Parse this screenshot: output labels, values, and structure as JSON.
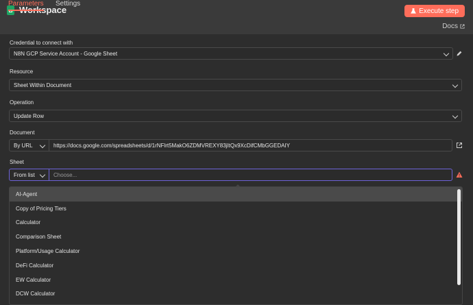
{
  "header": {
    "title": "Workspace",
    "execute_label": "Execute step",
    "tabs": [
      {
        "label": "Parameters"
      },
      {
        "label": "Settings"
      }
    ],
    "docs_label": "Docs"
  },
  "colors": {
    "accent": "#ff6d5a",
    "sheet_green": "#1fa463",
    "focus": "#6e63d9",
    "warning": "#ff6d5a"
  },
  "form": {
    "credential": {
      "label": "Credential to connect with",
      "value": "N8N GCP Service Account - Google Sheet"
    },
    "resource": {
      "label": "Resource",
      "value": "Sheet Within Document"
    },
    "operation": {
      "label": "Operation",
      "value": "Update Row"
    },
    "document": {
      "label": "Document",
      "mode": "By URL",
      "value": "https://docs.google.com/spreadsheets/d/1rNFlrt5MakO6ZDMVREXY83jItQx9XcDifCMbGGEDAIY"
    },
    "sheet": {
      "label": "Sheet",
      "mode": "From list",
      "placeholder": "Choose..."
    }
  },
  "dropdown": {
    "items": [
      {
        "label": "AI-Agent"
      },
      {
        "label": "Copy of Pricing Tiers"
      },
      {
        "label": "Calculator"
      },
      {
        "label": "Comparison Sheet"
      },
      {
        "label": "Platform/Usage Calculator"
      },
      {
        "label": "DeFi Calculator"
      },
      {
        "label": "EW Calculator"
      },
      {
        "label": "DCW Calculator"
      }
    ]
  }
}
